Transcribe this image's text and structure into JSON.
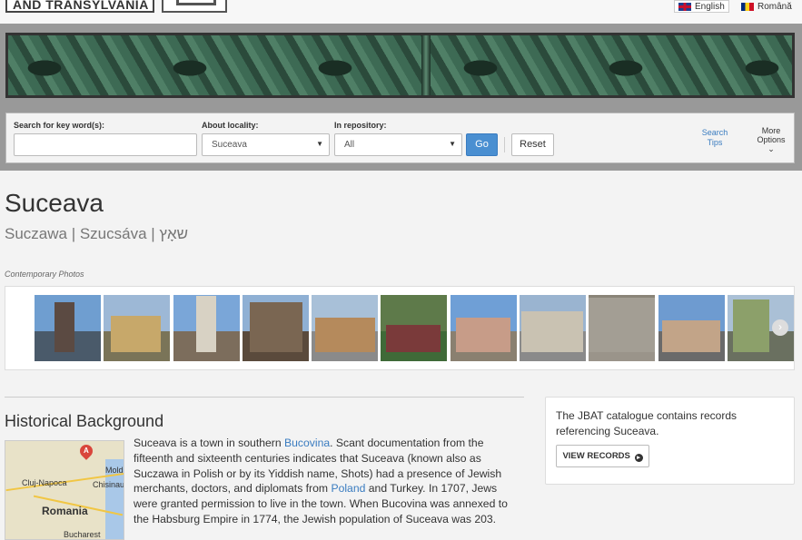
{
  "header": {
    "logo_text": "AND TRANSYLVANIA",
    "languages": [
      {
        "label": "English",
        "flag": "uk-flag-icon"
      },
      {
        "label": "Română",
        "flag": "romania-flag-icon"
      }
    ]
  },
  "search": {
    "keyword_label": "Search for key word(s):",
    "keyword_value": "",
    "locality_label": "About locality:",
    "locality_value": "Suceava",
    "repository_label": "In repository:",
    "repository_value": "All",
    "go_label": "Go",
    "reset_label": "Reset",
    "tips_label": "Search Tips",
    "more_label": "More Options",
    "more_icon": "⌄",
    "go_color": "#4a8fd1"
  },
  "main": {
    "title": "Suceava",
    "alt_names": "Suczawa | Szucsáva | שאָץ",
    "photos_label": "Contemporary Photos",
    "photos": [
      "photo-1",
      "photo-2",
      "photo-3",
      "photo-4",
      "photo-5",
      "photo-6",
      "photo-7",
      "photo-8",
      "photo-9",
      "photo-10",
      "photo-11"
    ],
    "section_title": "Historical Background",
    "map_labels": {
      "pin": "A",
      "moldova": "Mold",
      "cluj": "Cluj-Napoca",
      "chisinau": "Chisinau",
      "romania": "Romania",
      "bucharest": "Bucharest"
    },
    "paragraph": {
      "p1": "Suceava is a town in southern ",
      "link1": "Bucovina",
      "p2": ". Scant documentation from the fifteenth and sixteenth centuries indicates that Suceava (known also as Suczawa in Polish or by its Yiddish name, Shots) had a presence of Jewish merchants, doctors, and diplomats from ",
      "link2": "Poland",
      "p3": " and Turkey. In 1707, Jews were granted permission to live in the town. When Bucovina was annexed to the Habsburg Empire in 1774, the Jewish population of Suceava was 203."
    }
  },
  "sidebar": {
    "text": "The JBAT catalogue contains records referencing Suceava.",
    "button_label": "VIEW RECORDS",
    "button_icon": "▸"
  }
}
